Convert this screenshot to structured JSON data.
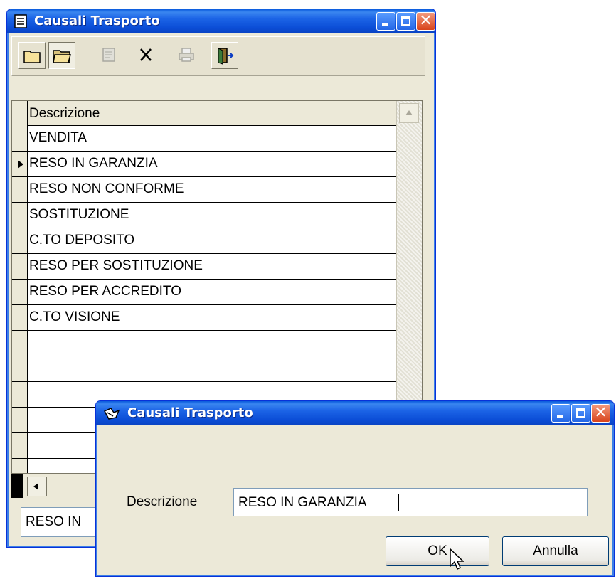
{
  "main_window": {
    "title": "Causali Trasporto",
    "toolbar": {
      "buttons": [
        {
          "name": "new",
          "icon": "folder-closed-icon"
        },
        {
          "name": "open",
          "icon": "folder-open-icon"
        },
        {
          "name": "edit",
          "icon": "edit-icon"
        },
        {
          "name": "delete",
          "icon": "delete-x-icon"
        },
        {
          "name": "print",
          "icon": "printer-icon"
        },
        {
          "name": "exit",
          "icon": "exit-door-icon"
        }
      ]
    },
    "grid": {
      "column_header": "Descrizione",
      "rows": [
        "VENDITA",
        "RESO IN GARANZIA",
        "RESO NON CONFORME",
        "SOSTITUZIONE",
        "C.TO DEPOSITO",
        "RESO PER SOSTITUZIONE",
        "RESO PER ACCREDITO",
        "C.TO VISIONE",
        "",
        "",
        "",
        "",
        "",
        ""
      ],
      "selected_index": 1
    },
    "bottom_field_value": "RESO IN"
  },
  "dialog": {
    "title": "Causali Trasporto",
    "field_label": "Descrizione",
    "field_value": "RESO IN GARANZIA",
    "ok_label": "OK",
    "cancel_label": "Annulla"
  },
  "colors": {
    "titlebar": "#0a5bdc",
    "window_face": "#ece9d8",
    "close_button": "#d8431c"
  }
}
